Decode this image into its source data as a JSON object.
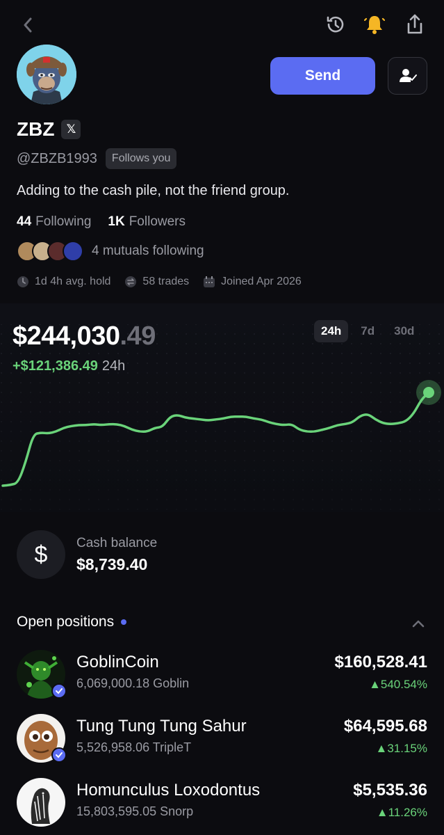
{
  "nav": {
    "back_icon": "chevron-left-icon",
    "history_icon": "history-icon",
    "notify_icon": "bell-icon",
    "share_icon": "share-icon"
  },
  "profile": {
    "name": "ZBZ",
    "x_badge": "𝕏",
    "handle": "@ZBZB1993",
    "follows_badge": "Follows you",
    "bio": "Adding to the cash pile, not the friend group.",
    "following_count": "44",
    "following_label": "Following",
    "followers_count": "1K",
    "followers_label": "Followers",
    "mutuals_text": "4 mutuals following",
    "stats": {
      "avg_hold": "1d 4h avg. hold",
      "trades": "58 trades",
      "joined": "Joined Apr 2026"
    }
  },
  "actions": {
    "send_label": "Send",
    "follow_icon": "user-check-icon"
  },
  "portfolio": {
    "value_main": "$244,030",
    "value_cents": ".49",
    "change_amount": "+$121,386.49",
    "change_period": "24h",
    "ranges": [
      "24h",
      "7d",
      "30d"
    ],
    "active_range": "24h"
  },
  "chart_data": {
    "type": "line",
    "title": "",
    "xlabel": "",
    "ylabel": "",
    "grid": false,
    "color": "#6ad37a",
    "values": [
      0,
      0.8,
      3,
      25,
      55,
      57,
      56,
      58,
      62,
      64,
      65,
      65,
      66,
      65,
      66,
      66,
      64,
      60,
      58,
      58,
      62,
      63,
      74,
      76,
      73,
      72,
      71,
      70,
      71,
      72,
      74,
      74,
      74,
      72,
      71,
      68,
      66,
      65,
      66,
      60,
      58,
      58,
      60,
      62,
      65,
      66,
      68,
      75,
      77,
      71,
      67,
      66,
      67,
      69,
      77,
      92,
      100
    ],
    "ylim": [
      0,
      100
    ]
  },
  "cash": {
    "icon": "dollar-icon",
    "label": "Cash balance",
    "value": "$8,739.40"
  },
  "positions": {
    "title": "Open positions",
    "collapse_icon": "chevron-up-icon",
    "items": [
      {
        "name": "GoblinCoin",
        "amount": "6,069,000.18 Goblin",
        "value": "$160,528.41",
        "change": "▲540.54%"
      },
      {
        "name": "Tung Tung Tung Sahur",
        "amount": "5,526,958.06 TripleT",
        "value": "$64,595.68",
        "change": "▲31.15%"
      },
      {
        "name": "Homunculus Loxodontus",
        "amount": "15,803,595.05 Snorp",
        "value": "$5,535.36",
        "change": "▲11.26%"
      }
    ]
  },
  "colors": {
    "accent": "#5b6cf2",
    "positive": "#6ad37a",
    "background": "#0c0c10",
    "bell": "#f5b625"
  }
}
